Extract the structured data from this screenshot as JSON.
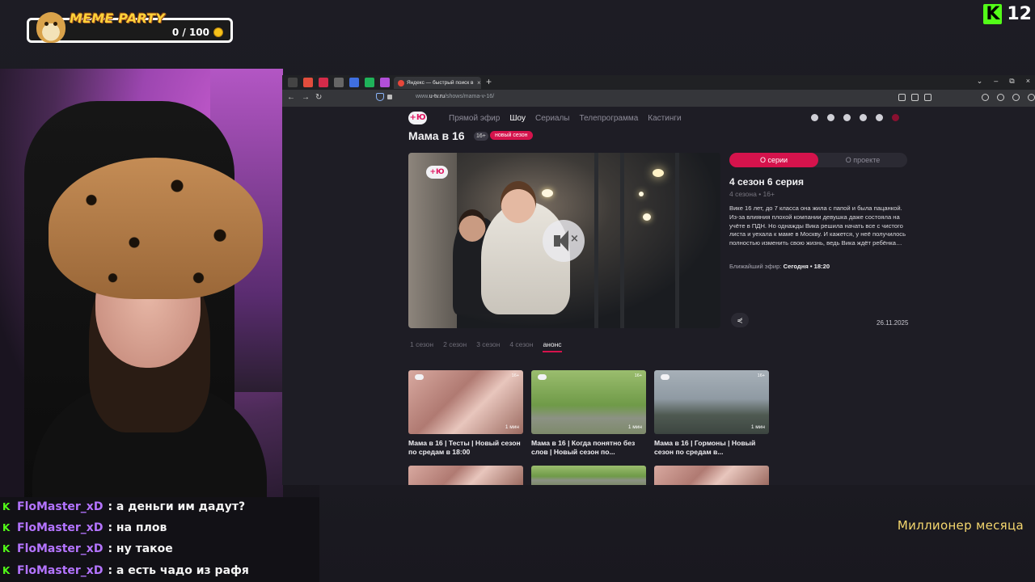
{
  "overlay": {
    "meme_party": {
      "title": "MEME PARTY",
      "counter": "0 / 100",
      "dog_icon": "doge-icon",
      "coin_icon": "coin-icon"
    },
    "kick": {
      "logo": "K",
      "number": "12",
      "accent": "#53fc18"
    },
    "million_label": "Миллионер месяца"
  },
  "browser": {
    "tabs": {
      "active_title": "Яндекс — быстрый поиск в интернете",
      "new_tab": "+",
      "close": "×"
    },
    "window_controls": {
      "chevron": "⌄",
      "minimize": "–",
      "maximize": "⧉",
      "close": "×"
    },
    "address": {
      "domain": "www.",
      "host": "u-tv.ru",
      "path": "/shows/mama-v-16/"
    },
    "nav_buttons": {
      "back": "←",
      "forward": "→",
      "reload": "↻"
    }
  },
  "site": {
    "logo": "+Ю",
    "nav": [
      "Прямой эфир",
      "Шоу",
      "Сериалы",
      "Телепрограмма",
      "Кастинги"
    ],
    "nav_active_index": 1,
    "show_title": "Мама в 16",
    "age_badge": "16+",
    "new_badge": "новый сезон",
    "player_watermark": "+Ю",
    "mute_mark": "×",
    "tabs": {
      "episode": "О серии",
      "project": "О проекте"
    },
    "episode": {
      "title": "4 сезон 6 серия",
      "meta": "4 сезона  •  16+",
      "description": "Вике 16 лет, до 7 класса она жила с папой и была пацанкой. Из-за влияния плохой компании девушка даже состояла на учёте в ПДН. Но однажды Вика решила начать все с чистого листа и уехала к маме в Москву. И кажется, у неё получилось полностью изменить свою жизнь, ведь Вика ждёт ребёнка…",
      "next_air_label": "Ближайший эфир:",
      "next_air_value": "Сегодня  •  18:20",
      "date": "26.11.2025",
      "share_icon": "share-icon",
      "share_glyph": "⋞"
    },
    "seasons": [
      "1 сезон",
      "2 сезон",
      "3 сезон",
      "4 сезон",
      "анонс"
    ],
    "seasons_active_index": 4,
    "cards": [
      {
        "title": "Мама в 16 | Тесты | Новый сезон по средам в 18:00",
        "duration": "1 мин",
        "age": "16+"
      },
      {
        "title": "Мама в 16 | Когда понятно без слов | Новый сезон по...",
        "duration": "1 мин",
        "age": "16+"
      },
      {
        "title": "Мама в 16 | Гормоны | Новый сезон по средам в...",
        "duration": "1 мин",
        "age": "16+"
      }
    ],
    "accent": "#d5134c"
  },
  "chat": {
    "badge": "K",
    "messages": [
      {
        "user": "FloMaster_xD",
        "text": ": а деньги им дадут?"
      },
      {
        "user": "FloMaster_xD",
        "text": ": на плов"
      },
      {
        "user": "FloMaster_xD",
        "text": ": ну такое"
      },
      {
        "user": "FloMaster_xD",
        "text": ": а есть чадо из рафя"
      }
    ],
    "user_color": "#b474ff"
  }
}
